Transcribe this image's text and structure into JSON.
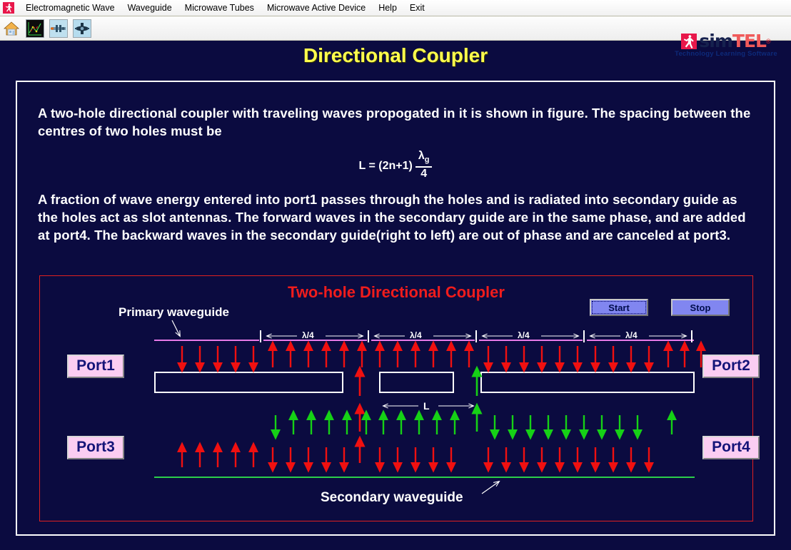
{
  "menu": {
    "logo_icon": "simtel-mark-icon",
    "items": [
      {
        "label": "Electromagnetic Wave"
      },
      {
        "label": "Waveguide"
      },
      {
        "label": "Microwave Tubes"
      },
      {
        "label": "Microwave Active Device"
      },
      {
        "label": "Help"
      },
      {
        "label": "Exit"
      }
    ]
  },
  "toolbar": {
    "buttons": [
      {
        "icon": "home-icon",
        "name": "home-button"
      },
      {
        "icon": "waveform-chart-icon",
        "name": "chart-button"
      },
      {
        "icon": "waveguide-device-icon",
        "name": "waveguide-button"
      },
      {
        "icon": "microwave-tube-icon",
        "name": "tube-button"
      }
    ]
  },
  "brand": {
    "sim": "sim",
    "tel": "TEL",
    "registered": "®",
    "tagline": "Technology Learning Software",
    "mark_color": "#e8174a",
    "sim_color": "#16214e",
    "tel_color": "#f05a5a"
  },
  "page": {
    "title": "Directional Coupler",
    "title_color": "#ffff4d"
  },
  "content": {
    "paragraph1": "A two-hole directional coupler with traveling waves propogated in it is shown in figure. The spacing between the centres of two holes must be",
    "formula": {
      "lhs": "L = (2n+1)",
      "numerator": "λg",
      "denominator": "4"
    },
    "paragraph2": "A fraction of wave energy entered into port1 passes through the holes and is radiated into secondary guide as the holes act as slot antennas. The forward waves in the secondary guide are in the same phase, and are added at port4. The backward waves in the secondary guide(right to left) are out of phase and are canceled at port3."
  },
  "figure": {
    "title": "Two-hole Directional Coupler",
    "title_color": "#f01c1c",
    "border_color": "#e02020",
    "buttons": {
      "start": "Start",
      "stop": "Stop",
      "face_color": "#8186f0"
    },
    "labels": {
      "primary": "Primary waveguide",
      "secondary": "Secondary waveguide",
      "spacing": "L",
      "quarter_wave": "λ/4"
    },
    "ports": {
      "port1": "Port1",
      "port2": "Port2",
      "port3": "Port3",
      "port4": "Port4",
      "box_color": "#fbcdf2",
      "text_color": "#141478"
    },
    "quarter_sections": [
      "λ/4",
      "λ/4",
      "λ/4",
      "λ/4"
    ],
    "colors": {
      "primary_line": "#e77ae7",
      "secondary_line": "#2ccf4a",
      "red_arrow": "#f01010",
      "green_arrow": "#16d116",
      "wall": "#ffffff",
      "background": "#0b0b40"
    }
  }
}
